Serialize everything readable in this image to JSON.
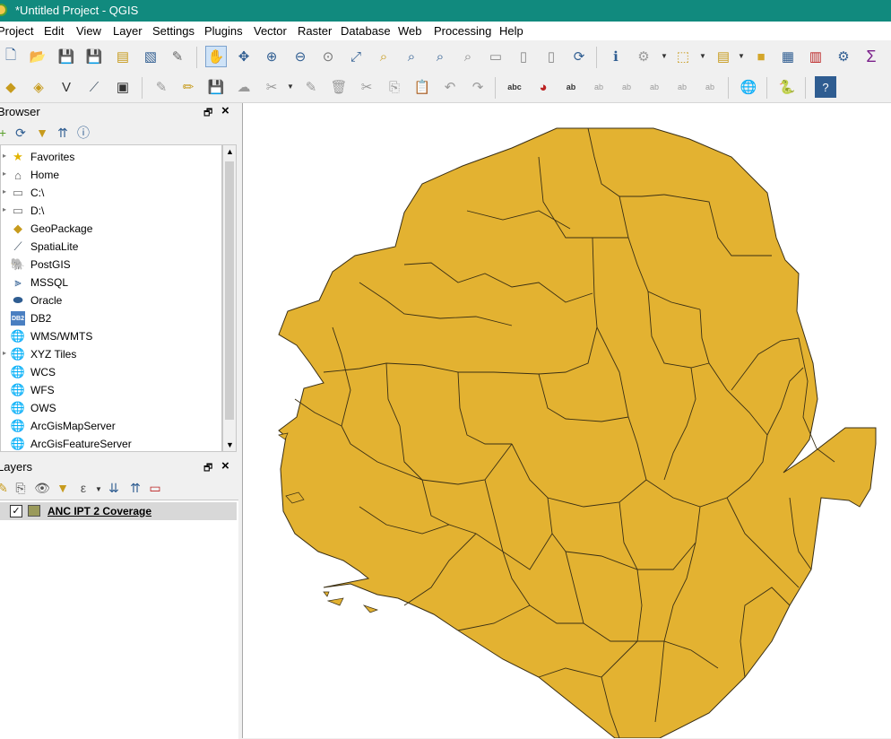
{
  "window": {
    "title": "*Untitled Project - QGIS"
  },
  "menus": [
    "Project",
    "Edit",
    "View",
    "Layer",
    "Settings",
    "Plugins",
    "Vector",
    "Raster",
    "Database",
    "Web",
    "Processing",
    "Help"
  ],
  "browser_panel": {
    "title": "Browser",
    "items": [
      {
        "label": "Favorites",
        "icon": "star-icon"
      },
      {
        "label": "Home",
        "icon": "home-folder-icon"
      },
      {
        "label": "C:\\",
        "icon": "folder-icon"
      },
      {
        "label": "D:\\",
        "icon": "folder-icon"
      },
      {
        "label": "GeoPackage",
        "icon": "geopackage-icon"
      },
      {
        "label": "SpatiaLite",
        "icon": "spatialite-icon"
      },
      {
        "label": "PostGIS",
        "icon": "postgis-icon"
      },
      {
        "label": "MSSQL",
        "icon": "mssql-icon"
      },
      {
        "label": "Oracle",
        "icon": "oracle-icon"
      },
      {
        "label": "DB2",
        "icon": "db2-icon"
      },
      {
        "label": "WMS/WMTS",
        "icon": "globe-icon"
      },
      {
        "label": "XYZ Tiles",
        "icon": "globe-icon"
      },
      {
        "label": "WCS",
        "icon": "globe-icon"
      },
      {
        "label": "WFS",
        "icon": "globe-icon"
      },
      {
        "label": "OWS",
        "icon": "globe-icon"
      },
      {
        "label": "ArcGisMapServer",
        "icon": "globe-icon"
      },
      {
        "label": "ArcGisFeatureServer",
        "icon": "globe-icon"
      }
    ]
  },
  "layers_panel": {
    "title": "Layers",
    "layers": [
      {
        "name": "ANC IPT 2 Coverage",
        "checked": true,
        "color": "#9a9a5b"
      }
    ]
  },
  "map": {
    "fill_color": "#e3b231",
    "stroke_color": "#3a2f14",
    "background": "#ffffff"
  },
  "colors": {
    "titlebar": "#118a7e",
    "accent": "#2f5d91"
  }
}
